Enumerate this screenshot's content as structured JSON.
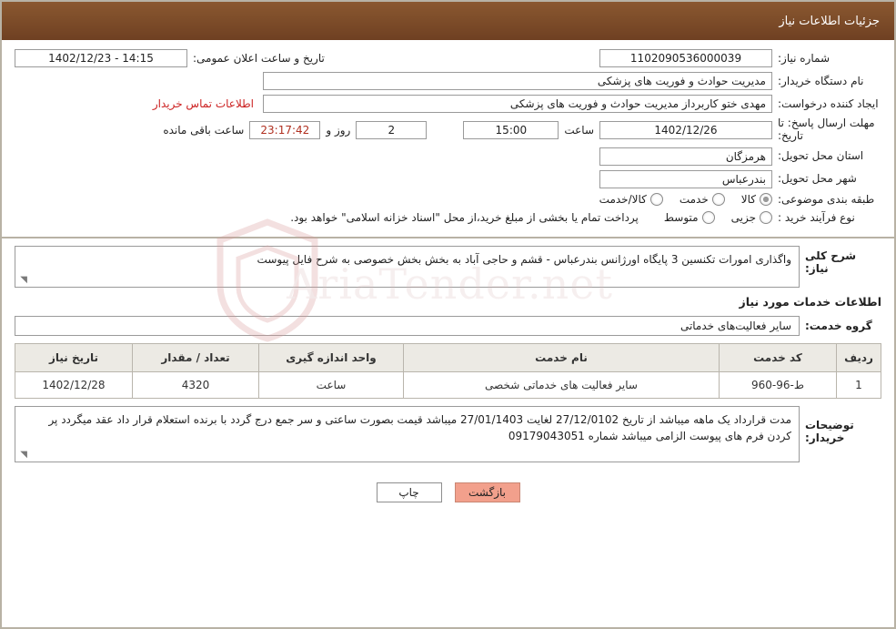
{
  "header": {
    "title": "جزئیات اطلاعات نیاز"
  },
  "info": {
    "need_number_label": "شماره نیاز:",
    "need_number_value": "1102090536000039",
    "announce_datetime_label": "تاریخ و ساعت اعلان عمومی:",
    "announce_datetime_value": "14:15 - 1402/12/23",
    "buyer_org_label": "نام دستگاه خریدار:",
    "buyer_org_value": "مدیریت حوادث و فوریت های پزشکی",
    "requester_label": "ایجاد کننده درخواست:",
    "requester_value": "مهدی ختو کاربرداز مدیریت حوادث و فوریت های پزشکی",
    "contact_link": "اطلاعات تماس خریدار",
    "deadline_label": "مهلت ارسال پاسخ: تا تاریخ:",
    "deadline_date": "1402/12/26",
    "deadline_hour_label": "ساعت",
    "deadline_hour": "15:00",
    "remaining_days": "2",
    "remaining_days_label": "روز و",
    "remaining_time": "23:17:42",
    "remaining_suffix": "ساعت باقی مانده",
    "province_label": "استان محل تحویل:",
    "province_value": "هرمزگان",
    "city_label": "شهر محل تحویل:",
    "city_value": "بندرعباس",
    "category_label": "طبقه بندی موضوعی:",
    "category_options": [
      {
        "label": "کالا",
        "selected": true
      },
      {
        "label": "خدمت",
        "selected": false
      },
      {
        "label": "کالا/خدمت",
        "selected": false
      }
    ],
    "purchase_type_label": "نوع فرآیند خرید :",
    "purchase_type_options": [
      {
        "label": "جزیی",
        "selected": false
      },
      {
        "label": "متوسط",
        "selected": false
      }
    ],
    "purchase_note": "پرداخت تمام یا بخشی از مبلغ خرید،از محل \"اسناد خزانه اسلامی\" خواهد بود."
  },
  "watermark": {
    "text": "AriaTender.net"
  },
  "body": {
    "general_desc_label": "شرح کلی نیاز:",
    "general_desc_value": "واگذاری امورات تکنسین 3 پایگاه اورژانس  بندرعباس  - قشم و  حاجی  آباد  به بخش   بخش  خصوصی به شرح  فایل پیوست",
    "services_section_title": "اطلاعات خدمات مورد نیاز",
    "service_group_label": "گروه خدمت:",
    "service_group_value": "سایر فعالیت‌های خدماتی",
    "table": {
      "headers": [
        "ردیف",
        "کد خدمت",
        "نام خدمت",
        "واحد اندازه گیری",
        "تعداد / مقدار",
        "تاریخ نیاز"
      ],
      "rows": [
        {
          "row": "1",
          "code": "ط-96-960",
          "name": "سایر فعالیت های خدماتی شخصی",
          "unit": "ساعت",
          "qty": "4320",
          "date": "1402/12/28"
        }
      ]
    },
    "buyer_notes_label": "توضیحات خریدار:",
    "buyer_notes_value": "مدت قرارداد یک ماهه میباشد از تاریخ 27/12/0102  لغایت  27/01/1403 میباشد  قیمت بصورت  ساعتی و سر جمع  درج گردد با برنده استعلام قرار داد  عقد میگردد  پر کردن    فرم های پیوست الزامی میباشد  شماره  09179043051"
  },
  "footer": {
    "print_label": "چاپ",
    "back_label": "بازگشت"
  },
  "colors": {
    "header_bg": "#7a4a2a",
    "link": "#cc2222",
    "back_button": "#f2a08c",
    "table_header_bg": "#eceae4",
    "border": "#b8b2a5"
  }
}
